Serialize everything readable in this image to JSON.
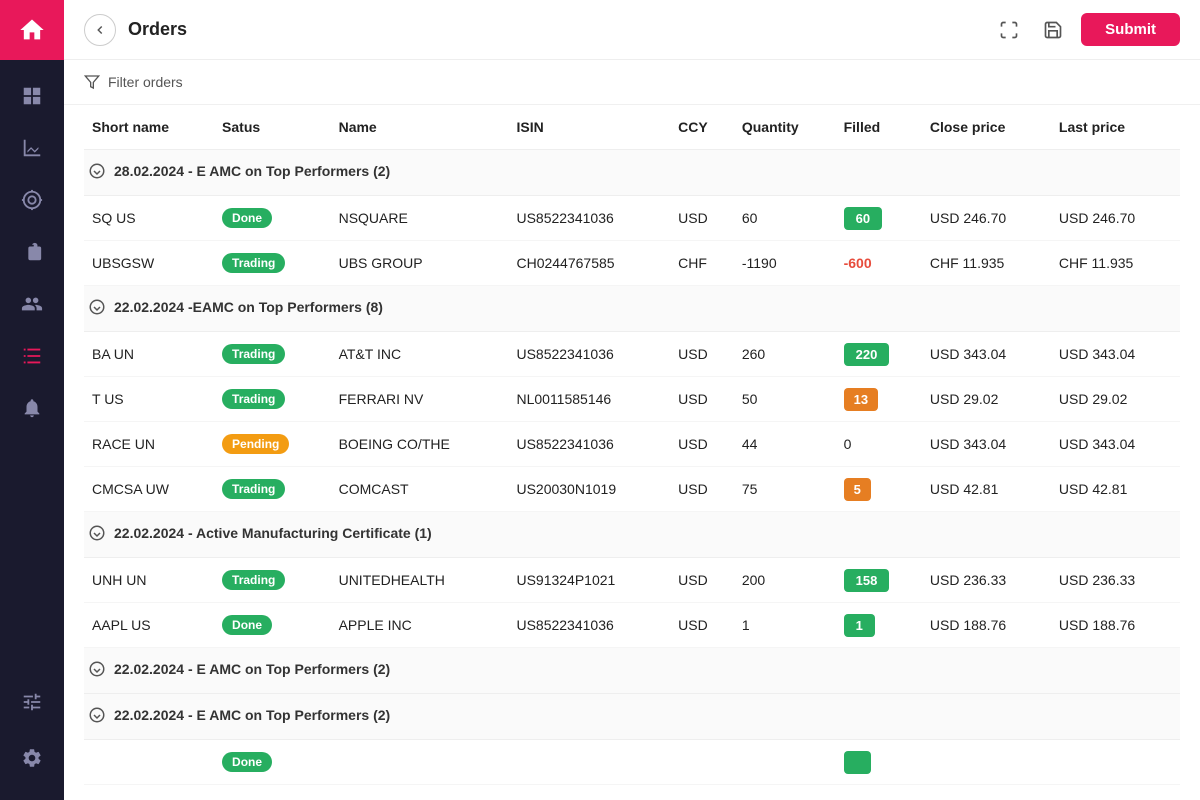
{
  "sidebar": {
    "logo_label": "Home",
    "items": [
      {
        "id": "dashboard",
        "icon": "grid-icon",
        "active": false
      },
      {
        "id": "analytics",
        "icon": "chart-icon",
        "active": false
      },
      {
        "id": "search",
        "icon": "search-icon",
        "active": false
      },
      {
        "id": "portfolio",
        "icon": "folder-icon",
        "active": false
      },
      {
        "id": "users",
        "icon": "users-icon",
        "active": false
      },
      {
        "id": "orders",
        "icon": "list-icon",
        "active": true
      },
      {
        "id": "notifications",
        "icon": "bell-icon",
        "active": false
      }
    ],
    "bottom_items": [
      {
        "id": "sliders",
        "icon": "sliders-icon"
      },
      {
        "id": "settings",
        "icon": "settings-icon"
      }
    ]
  },
  "header": {
    "title": "Orders",
    "submit_label": "Submit"
  },
  "filter_bar": {
    "label": "Filter orders"
  },
  "table": {
    "columns": [
      "Short name",
      "Satus",
      "Name",
      "ISIN",
      "CCY",
      "Quantity",
      "Filled",
      "Close price",
      "Last price"
    ],
    "groups": [
      {
        "id": "group1",
        "label": "28.02.2024 - E AMC on Top Performers (2)",
        "rows": [
          {
            "short_name": "SQ US",
            "status": "Done",
            "status_type": "done",
            "name": "NSQUARE",
            "isin": "US8522341036",
            "ccy": "USD",
            "quantity": "60",
            "filled": "60",
            "filled_type": "green",
            "filled_pct": 100,
            "close_price": "USD 246.70",
            "last_price": "USD 246.70"
          },
          {
            "short_name": "UBSGSW",
            "status": "Trading",
            "status_type": "trading",
            "name": "UBS GROUP",
            "isin": "CH0244767585",
            "ccy": "CHF",
            "quantity": "-1190",
            "filled": "-600",
            "filled_type": "red",
            "close_price": "CHF 11.935",
            "last_price": "CHF 11.935"
          }
        ]
      },
      {
        "id": "group2",
        "label": "22.02.2024 -EAMC on Top Performers (8)",
        "rows": [
          {
            "short_name": "BA UN",
            "status": "Trading",
            "status_type": "trading",
            "name": "AT&T INC",
            "isin": "US8522341036",
            "ccy": "USD",
            "quantity": "260",
            "filled": "220",
            "filled_type": "green",
            "filled_pct": 85,
            "close_price": "USD 343.04",
            "last_price": "USD 343.04"
          },
          {
            "short_name": "T US",
            "status": "Trading",
            "status_type": "trading",
            "name": "FERRARI NV",
            "isin": "NL0011585146",
            "ccy": "USD",
            "quantity": "50",
            "filled": "13",
            "filled_type": "orange",
            "close_price": "USD 29.02",
            "last_price": "USD 29.02"
          },
          {
            "short_name": "RACE UN",
            "status": "Pending",
            "status_type": "pending",
            "name": "BOEING CO/THE",
            "isin": "US8522341036",
            "ccy": "USD",
            "quantity": "44",
            "filled": "0",
            "filled_type": "zero",
            "close_price": "USD 343.04",
            "last_price": "USD 343.04"
          },
          {
            "short_name": "CMCSA UW",
            "status": "Trading",
            "status_type": "trading",
            "name": "COMCAST",
            "isin": "US20030N1019",
            "ccy": "USD",
            "quantity": "75",
            "filled": "5",
            "filled_type": "orange",
            "close_price": "USD 42.81",
            "last_price": "USD 42.81"
          }
        ]
      },
      {
        "id": "group3",
        "label": "22.02.2024 -  Active Manufacturing Certificate (1)",
        "rows": [
          {
            "short_name": "UNH UN",
            "status": "Trading",
            "status_type": "trading",
            "name": "UNITEDHEALTH",
            "isin": "US91324P1021",
            "ccy": "USD",
            "quantity": "200",
            "filled": "158",
            "filled_type": "green",
            "filled_pct": 79,
            "close_price": "USD 236.33",
            "last_price": "USD 236.33"
          },
          {
            "short_name": "AAPL US",
            "status": "Done",
            "status_type": "done",
            "name": "APPLE INC",
            "isin": "US8522341036",
            "ccy": "USD",
            "quantity": "1",
            "filled": "1",
            "filled_type": "green",
            "filled_pct": 100,
            "close_price": "USD 188.76",
            "last_price": "USD 188.76"
          }
        ]
      },
      {
        "id": "group4",
        "label": "22.02.2024 - E AMC on Top Performers (2)",
        "rows": [
          {
            "short_name": "",
            "status": "Done",
            "status_type": "done",
            "name": "",
            "isin": "",
            "ccy": "",
            "quantity": "",
            "filled": "",
            "filled_type": "green",
            "filled_pct": 100,
            "close_price": "",
            "last_price": ""
          }
        ]
      }
    ]
  }
}
